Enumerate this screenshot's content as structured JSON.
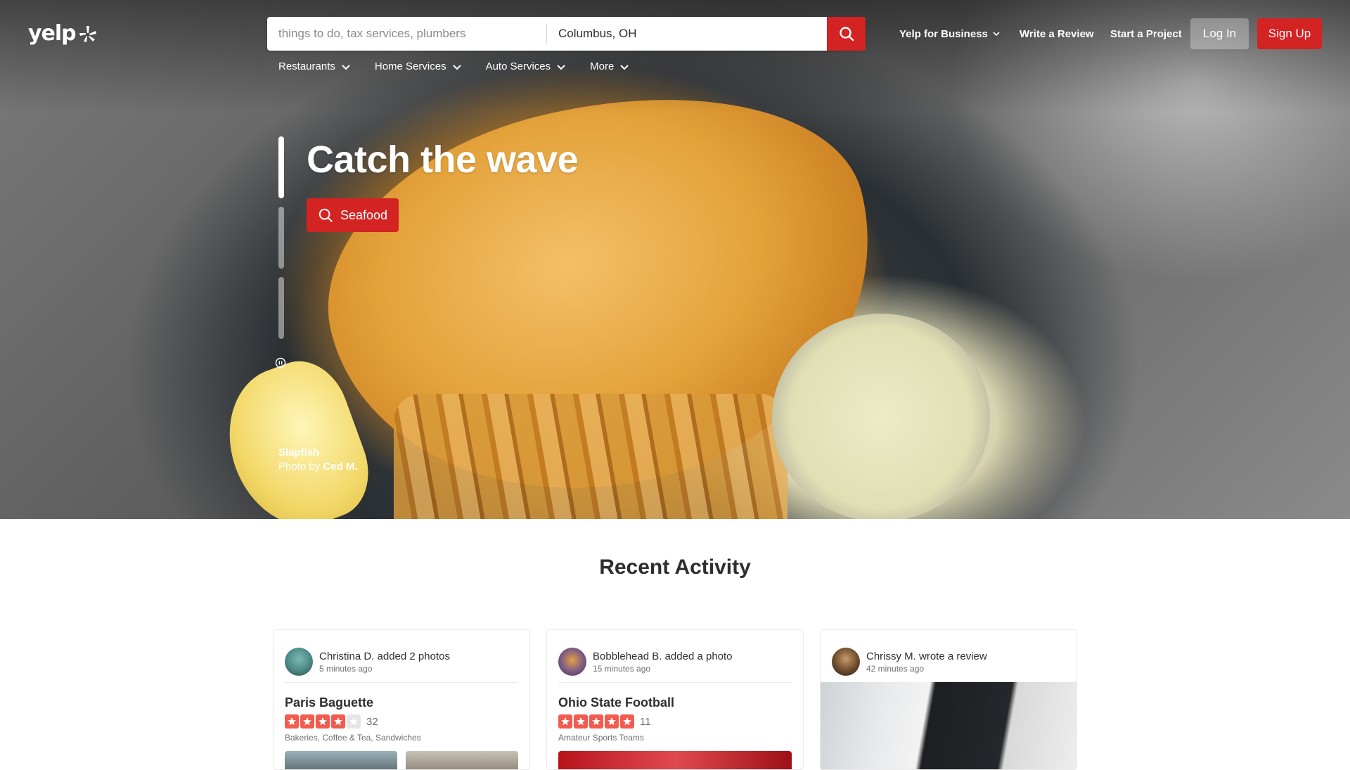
{
  "brand": {
    "logo_text": "yelp",
    "accent": "#d32323"
  },
  "search": {
    "find_placeholder": "things to do, tax services, plumbers",
    "near_value": "Columbus, OH"
  },
  "header": {
    "yelp_for_business": "Yelp for Business",
    "write_review": "Write a Review",
    "start_project": "Start a Project",
    "login": "Log In",
    "signup": "Sign Up"
  },
  "categories": [
    {
      "label": "Restaurants"
    },
    {
      "label": "Home Services"
    },
    {
      "label": "Auto Services"
    },
    {
      "label": "More"
    }
  ],
  "hero": {
    "headline": "Catch the wave",
    "cta_label": "Seafood",
    "photo_business": "Slapfish",
    "photo_by_prefix": "Photo by",
    "photo_by_name": "Ced M.",
    "slides_total": 3,
    "active_slide": 1
  },
  "recent_activity": {
    "title": "Recent Activity",
    "cards": [
      {
        "user_action": "Christina D. added 2 photos",
        "time": "5 minutes ago",
        "business": "Paris Baguette",
        "rating": 4,
        "review_count": "32",
        "categories": "Bakeries, Coffee & Tea, Sandwiches"
      },
      {
        "user_action": "Bobblehead B. added a photo",
        "time": "15 minutes ago",
        "business": "Ohio State Football",
        "rating": 5,
        "review_count": "11",
        "categories": "Amateur Sports Teams"
      },
      {
        "user_action": "Chrissy M. wrote a review",
        "time": "42 minutes ago"
      }
    ]
  }
}
